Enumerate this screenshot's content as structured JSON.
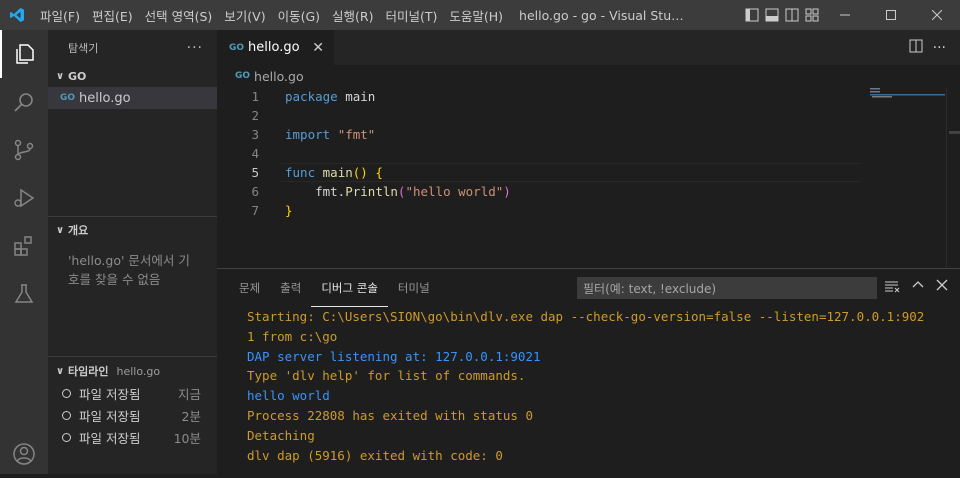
{
  "titlebar": {
    "menu": [
      "파일(F)",
      "편집(E)",
      "선택 영역(S)",
      "보기(V)",
      "이동(G)",
      "실행(R)",
      "터미널(T)",
      "도움말(H)"
    ],
    "window_title": "hello.go - go - Visual Studio Code"
  },
  "sidebar": {
    "header": "탐색기",
    "folder": "GO",
    "file": "hello.go",
    "outline_header": "개요",
    "outline_message": "'hello.go' 문서에서 기호를 찾을 수 없음",
    "timeline_header": "타임라인",
    "timeline_file": "hello.go",
    "timeline": [
      {
        "label": "파일 저장됨",
        "time": "지금"
      },
      {
        "label": "파일 저장됨",
        "time": "2분"
      },
      {
        "label": "파일 저장됨",
        "time": "10분"
      }
    ]
  },
  "editor": {
    "tab": "hello.go",
    "breadcrumb": "hello.go",
    "line_numbers": [
      "1",
      "2",
      "3",
      "4",
      "5",
      "6",
      "7"
    ]
  },
  "panel": {
    "tabs": [
      "문제",
      "출력",
      "디버그 콘솔",
      "터미널"
    ],
    "filter_placeholder": "필터(예: text, !exclude)",
    "console": [
      {
        "text": "Starting: C:\\Users\\SION\\go\\bin\\dlv.exe dap --check-go-version=false --listen=127.0.0.1:902",
        "color": "orange"
      },
      {
        "text": "1 from c:\\go",
        "color": "orange"
      },
      {
        "text": "DAP server listening at: 127.0.0.1:9021",
        "color": "blue"
      },
      {
        "text": "Type 'dlv help' for list of commands.",
        "color": "orange"
      },
      {
        "text": "hello world",
        "color": "blue"
      },
      {
        "text": "Process 22808 has exited with status 0",
        "color": "orange"
      },
      {
        "text": "Detaching",
        "color": "orange"
      },
      {
        "text": "dlv dap (5916) exited with code: 0",
        "color": "orange"
      }
    ]
  },
  "colors": {
    "accent": "#007acc",
    "activity": "#333333",
    "sidebar": "#252526",
    "editor": "#1e1e1e"
  }
}
